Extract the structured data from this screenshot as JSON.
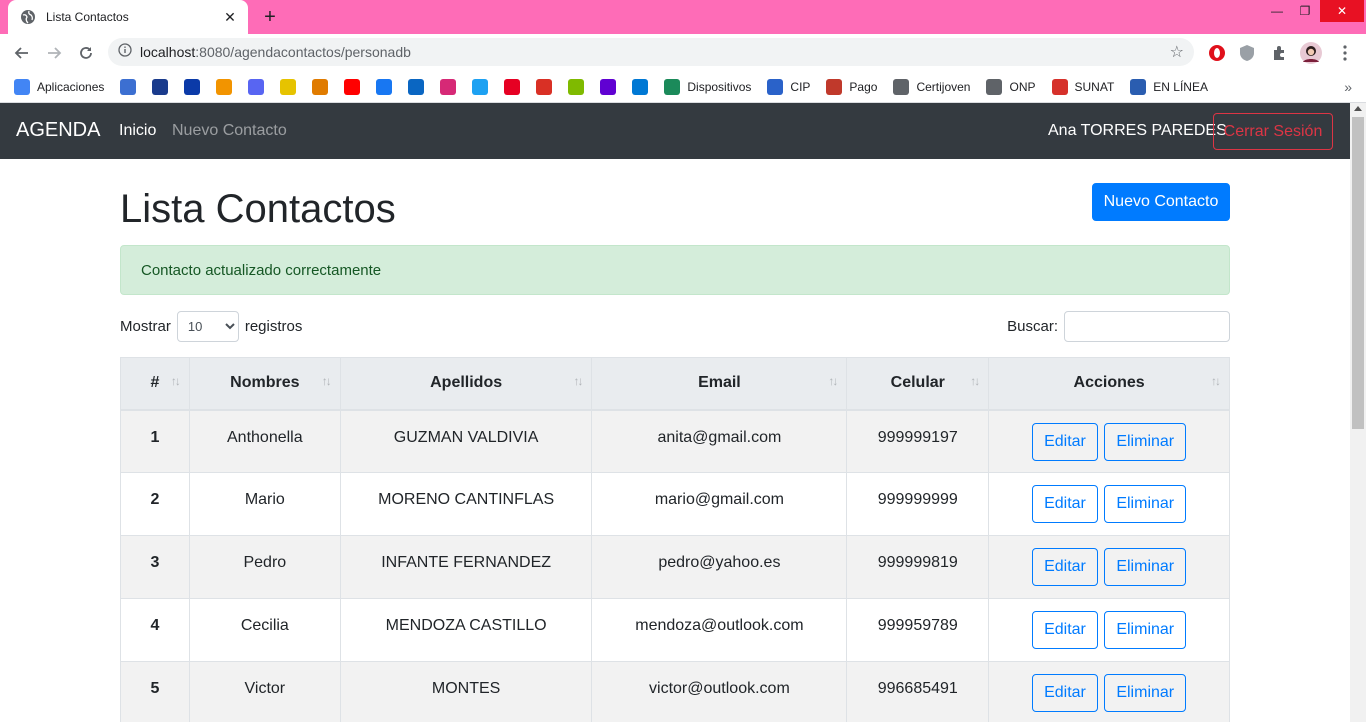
{
  "browser": {
    "tab_title": "Lista Contactos",
    "url_host": "localhost",
    "url_rest": ":8080/agendacontactos/personadb",
    "bookmarks": [
      {
        "icon": "apps-grid-icon",
        "label": "Aplicaciones",
        "color": "#4285f4"
      },
      {
        "icon": "globe-icon",
        "label": "",
        "color": "#3c6fd1"
      },
      {
        "icon": "a-logo-icon",
        "label": "",
        "color": "#1a3b8c"
      },
      {
        "icon": "square-logo-icon",
        "label": "",
        "color": "#0b3aa8"
      },
      {
        "icon": "play-arrow-icon",
        "label": "",
        "color": "#f29400"
      },
      {
        "icon": "discord-icon",
        "label": "",
        "color": "#5865f2"
      },
      {
        "icon": "yellow-code-icon",
        "label": "",
        "color": "#e6c300"
      },
      {
        "icon": "wr-icon",
        "label": "",
        "color": "#e07b00"
      },
      {
        "icon": "youtube-icon",
        "label": "",
        "color": "#ff0000"
      },
      {
        "icon": "facebook-icon",
        "label": "",
        "color": "#1877f2"
      },
      {
        "icon": "linkedin-icon",
        "label": "",
        "color": "#0a66c2"
      },
      {
        "icon": "instagram-icon",
        "label": "",
        "color": "#d62976"
      },
      {
        "icon": "twitter-icon",
        "label": "",
        "color": "#1da1f2"
      },
      {
        "icon": "pinterest-icon",
        "label": "",
        "color": "#e60023"
      },
      {
        "icon": "gmail-icon",
        "label": "",
        "color": "#d93025"
      },
      {
        "icon": "microsoft-icon",
        "label": "",
        "color": "#7fba00"
      },
      {
        "icon": "yahoo-icon",
        "label": "",
        "color": "#6001d2"
      },
      {
        "icon": "outlook-icon",
        "label": "",
        "color": "#0078d4"
      },
      {
        "icon": "k-logo-icon",
        "label": "Dispositivos",
        "color": "#1b8a5a"
      },
      {
        "icon": "cip-icon",
        "label": "CIP",
        "color": "#2a62c9"
      },
      {
        "icon": "pago-icon",
        "label": "Pago",
        "color": "#c0392b"
      },
      {
        "icon": "globe-icon",
        "label": "Certijoven",
        "color": "#5f6368"
      },
      {
        "icon": "globe-icon",
        "label": "ONP",
        "color": "#5f6368"
      },
      {
        "icon": "sunat-icon",
        "label": "SUNAT",
        "color": "#d6312b"
      },
      {
        "icon": "people-icon",
        "label": "EN LÍNEA",
        "color": "#2a5db0"
      }
    ]
  },
  "nav": {
    "brand": "AGENDA",
    "links": [
      {
        "label": "Inicio",
        "active": true
      },
      {
        "label": "Nuevo Contacto",
        "active": false
      }
    ],
    "user": "Ana TORRES PAREDES",
    "logout": "Cerrar Sesión"
  },
  "main": {
    "title": "Lista Contactos",
    "new_button": "Nuevo Contacto",
    "alert": "Contacto actualizado correctamente",
    "length_prefix": "Mostrar",
    "length_value": "10",
    "length_suffix": "registros",
    "search_label": "Buscar:",
    "search_value": "",
    "columns": [
      "#",
      "Nombres",
      "Apellidos",
      "Email",
      "Celular",
      "Acciones"
    ],
    "rows": [
      {
        "num": "1",
        "nombres": "Anthonella",
        "apellidos": "GUZMAN VALDIVIA",
        "email": "anita@gmail.com",
        "celular": "999999197"
      },
      {
        "num": "2",
        "nombres": "Mario",
        "apellidos": "MORENO CANTINFLAS",
        "email": "mario@gmail.com",
        "celular": "999999999"
      },
      {
        "num": "3",
        "nombres": "Pedro",
        "apellidos": "INFANTE FERNANDEZ",
        "email": "pedro@yahoo.es",
        "celular": "999999819"
      },
      {
        "num": "4",
        "nombres": "Cecilia",
        "apellidos": "MENDOZA CASTILLO",
        "email": "mendoza@outlook.com",
        "celular": "999959789"
      },
      {
        "num": "5",
        "nombres": "Victor",
        "apellidos": "MONTES",
        "email": "victor@outlook.com",
        "celular": "996685491"
      }
    ],
    "edit_label": "Editar",
    "delete_label": "Eliminar"
  }
}
